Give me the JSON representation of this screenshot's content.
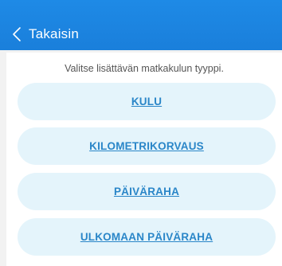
{
  "header": {
    "back_label": "Takaisin",
    "back_icon": "chevron-left-icon",
    "background_color": "#1a7fdb"
  },
  "main": {
    "instruction": "Valitse lisättävän matkakulun tyyppi.",
    "options": [
      {
        "label": "KULU"
      },
      {
        "label": "KILOMETRIKORVAUS"
      },
      {
        "label": "PÄIVÄRAHA"
      },
      {
        "label": "ULKOMAAN PÄIVÄRAHA"
      }
    ],
    "option_background": "#e4f4fb",
    "option_text_color": "#2a86c8"
  }
}
